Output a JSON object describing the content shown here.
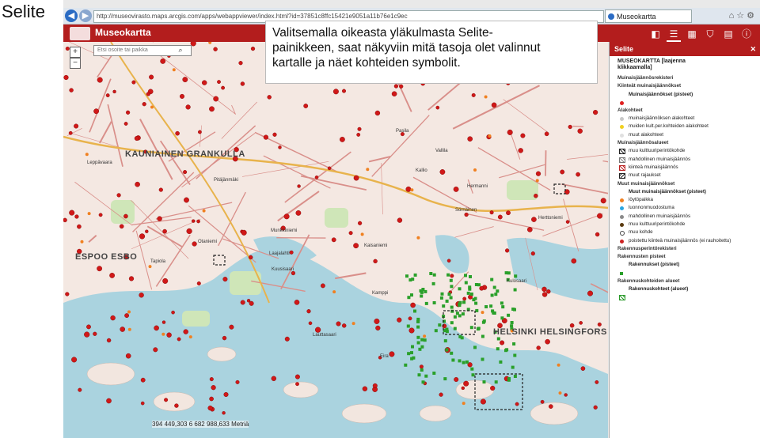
{
  "slide": {
    "title": "Selite"
  },
  "browser": {
    "url": "http://museovirasto.maps.arcgis.com/apps/webappviewer/index.html?id=37851c8ffc15421e9051a11b76e1c9ec",
    "tab_label": "Museokartta",
    "icons": [
      "home-icon",
      "star-icon",
      "gear-icon"
    ]
  },
  "app": {
    "title": "Museokartta",
    "tools": [
      {
        "name": "layers-tool",
        "glyph": "◧"
      },
      {
        "name": "legend-tool",
        "glyph": "☰"
      },
      {
        "name": "basemap-tool",
        "glyph": "▦"
      },
      {
        "name": "filter-tool",
        "glyph": "⛉"
      },
      {
        "name": "print-tool",
        "glyph": "▤"
      },
      {
        "name": "info-tool",
        "glyph": "ⓘ"
      }
    ]
  },
  "map": {
    "search_placeholder": "Etsi osoite tai paikka",
    "zoom_in": "+",
    "zoom_out": "−",
    "coordinates": "394 449,303  6 682 988,633 Metriä",
    "city_labels": [
      "KAUNIAINEN GRANKULLA",
      "ESPOO ESBO",
      "HELSINKI HELSINGFORS"
    ],
    "place_labels": [
      "Leppävaara",
      "Pitäjänmäki",
      "Munkkiniemi",
      "Lauttasaari",
      "Kuusisaari",
      "Kaisaniemi",
      "Kallio",
      "Vallila",
      "Sörnäinen",
      "Hermanni",
      "Pasila",
      "Kamppi",
      "Eira",
      "Kulosaari",
      "Herttoniemi",
      "Tapiola",
      "Otaniemi",
      "Laajalahti"
    ]
  },
  "callout": {
    "text": "Valitsemalla oikeasta yläkulmasta Selite-\npainikkeen, saat näkyviin mitä tasoja olet valinnut\nkartalle ja näet kohteiden symbolit."
  },
  "panel": {
    "header": "Selite",
    "close": "✕",
    "title_line1": "MUSEOKARTTA [laajenna",
    "title_line2": "klikkaamalla]",
    "rows": [
      {
        "kind": "group",
        "text": "Muinaisjäännösrekisteri",
        "sym": "hidden",
        "color": ""
      },
      {
        "kind": "group",
        "text": "Kiinteät muinaisjäännökset",
        "sym": "hidden",
        "color": ""
      },
      {
        "kind": "sub",
        "text": "Muinaisjäännökset (pisteet)",
        "sym": "hidden",
        "color": ""
      },
      {
        "kind": "item",
        "text": "",
        "sym": "dot",
        "color": "#e02020"
      },
      {
        "kind": "group",
        "text": "Alakohteet",
        "sym": "hidden",
        "color": ""
      },
      {
        "kind": "item",
        "text": "muinaisjäännöksen alakohteet",
        "sym": "dot",
        "color": "#c8c8c8"
      },
      {
        "kind": "item",
        "text": "muiden kult.per.kohteiden alakohteet",
        "sym": "dot",
        "color": "#f0d020"
      },
      {
        "kind": "item",
        "text": "muut alakohteet",
        "sym": "dot",
        "color": "#e0e0e0"
      },
      {
        "kind": "group",
        "text": "Muinaisjäännösalueet",
        "sym": "hidden",
        "color": ""
      },
      {
        "kind": "item",
        "text": "muu kulttuuriperintökohde",
        "sym": "hatch",
        "color": ""
      },
      {
        "kind": "item",
        "text": "mahdollinen muinaisjäännös",
        "sym": "hatch-gray",
        "color": ""
      },
      {
        "kind": "item",
        "text": "kiinteä muinaisjäännös",
        "sym": "hatch-red",
        "color": ""
      },
      {
        "kind": "item",
        "text": "muut rajaukset",
        "sym": "hatch-ring",
        "color": ""
      },
      {
        "kind": "group",
        "text": "Muut muinaisjäännökset",
        "sym": "hidden",
        "color": ""
      },
      {
        "kind": "sub",
        "text": "Muut muinaisjäännökset (pisteet)",
        "sym": "hidden",
        "color": ""
      },
      {
        "kind": "item",
        "text": "löytöpaikka",
        "sym": "dot",
        "color": "#f08020"
      },
      {
        "kind": "item",
        "text": "luonnonmuodostuma",
        "sym": "dot",
        "color": "#2aa6e0"
      },
      {
        "kind": "item",
        "text": "mahdollinen muinaisjäännös",
        "sym": "dot",
        "color": "#8a8a8a"
      },
      {
        "kind": "item",
        "text": "muu kulttuuriperintökohde",
        "sym": "dot",
        "color": "#5a3a10"
      },
      {
        "kind": "item",
        "text": "muu kohde",
        "sym": "ring",
        "color": ""
      },
      {
        "kind": "note",
        "text": "poistettu kiinteä muinaisjäännös (ei rauhoitettu)",
        "sym": "x-dot",
        "color": ""
      },
      {
        "kind": "group",
        "text": "Rakennusperintörekisteri",
        "sym": "hidden",
        "color": ""
      },
      {
        "kind": "group",
        "text": "Rakennusten pisteet",
        "sym": "hidden",
        "color": ""
      },
      {
        "kind": "sub",
        "text": "Rakennukset (pisteet)",
        "sym": "hidden",
        "color": ""
      },
      {
        "kind": "item",
        "text": "",
        "sym": "square",
        "color": "#2aa02a"
      },
      {
        "kind": "group",
        "text": "Rakennuskohteiden alueet",
        "sym": "hidden",
        "color": ""
      },
      {
        "kind": "sub",
        "text": "Rakennuskohteet (alueet)",
        "sym": "hidden",
        "color": ""
      },
      {
        "kind": "item",
        "text": "",
        "sym": "hatch-green",
        "color": ""
      }
    ]
  }
}
